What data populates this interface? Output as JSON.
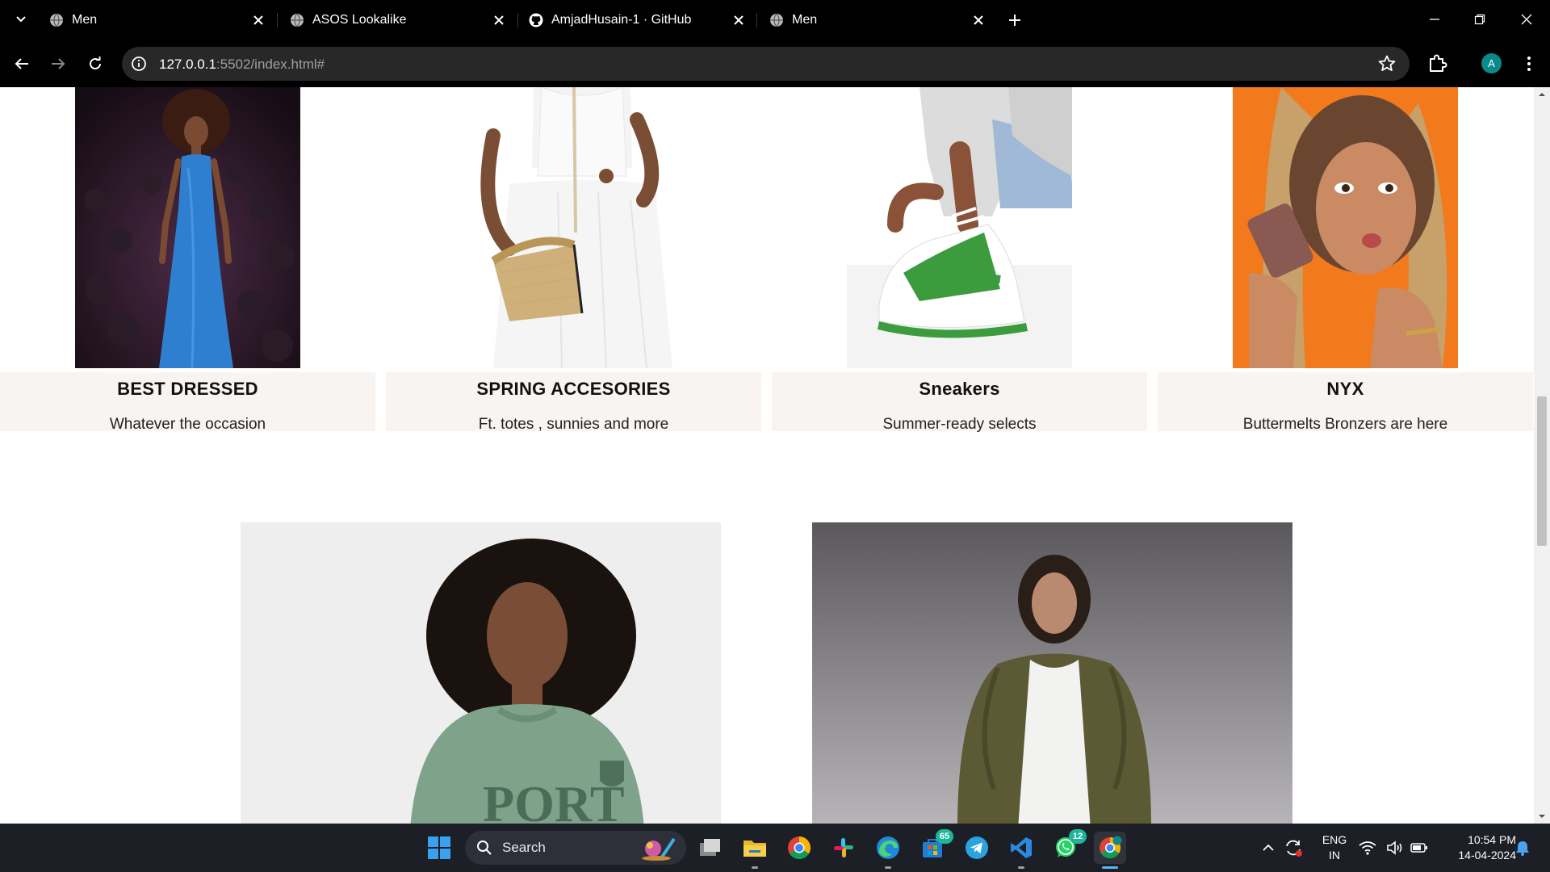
{
  "browser": {
    "tabs": [
      {
        "title": "Men",
        "favicon": "globe-icon",
        "active": false
      },
      {
        "title": "ASOS Lookalike",
        "favicon": "globe-icon",
        "active": false
      },
      {
        "title": "AmjadHusain-1 · GitHub",
        "favicon": "github-icon",
        "active": false
      },
      {
        "title": "Men",
        "favicon": "globe-icon",
        "active": true
      }
    ],
    "url_host": "127.0.0.1",
    "url_path": ":5502/index.html#",
    "profile_initial": "A",
    "profile_color": "#0a8a8a"
  },
  "page": {
    "categories": [
      {
        "title": "BEST DRESSED",
        "subtitle": "Whatever the occasion",
        "image": "model-blue-gown-photo"
      },
      {
        "title": "SPRING ACCESORIES",
        "subtitle": "Ft. totes , sunnies and more",
        "image": "straw-handbag-photo"
      },
      {
        "title": "Sneakers",
        "subtitle": "Summer-ready selects",
        "image": "green-sneakers-photo"
      },
      {
        "title": "NYX",
        "subtitle": "Buttermelts Bronzers are here",
        "image": "nyx-bronzer-photo"
      }
    ],
    "promos": [
      {
        "image": "green-sweatshirt-model-photo"
      },
      {
        "image": "khaki-bomber-model-photo"
      }
    ],
    "caption_bg": "#f8f4f2"
  },
  "taskbar": {
    "search_label": "Search",
    "apps": [
      {
        "name": "start",
        "badge": ""
      },
      {
        "name": "task-view",
        "badge": ""
      },
      {
        "name": "file-explorer",
        "badge": ""
      },
      {
        "name": "chrome",
        "badge": ""
      },
      {
        "name": "slack",
        "badge": ""
      },
      {
        "name": "edge",
        "badge": ""
      },
      {
        "name": "store",
        "badge": "65"
      },
      {
        "name": "telegram",
        "badge": ""
      },
      {
        "name": "vscode",
        "badge": ""
      },
      {
        "name": "whatsapp",
        "badge": "12"
      },
      {
        "name": "chrome-profile",
        "badge": ""
      }
    ],
    "lang_line1": "ENG",
    "lang_line2": "IN",
    "time": "10:54 PM",
    "date": "14-04-2024"
  }
}
